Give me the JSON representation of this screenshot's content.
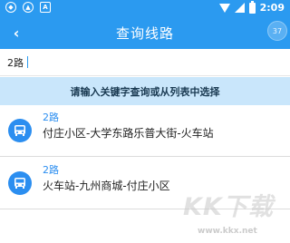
{
  "status_bar": {
    "left_icons": [
      "shield-icon",
      "navigation-icon",
      "a-icon"
    ],
    "time": "2:09"
  },
  "header": {
    "title": "查询线路",
    "badge": "37"
  },
  "search": {
    "value": "2路",
    "placeholder": ""
  },
  "hint": "请输入关键字查询或从列表中选择",
  "routes": [
    {
      "name": "2路",
      "stops": "付庄小区-大学东路乐普大街-火车站"
    },
    {
      "name": "2路",
      "stops": "火车站-九州商城-付庄小区"
    }
  ],
  "watermark": {
    "logo": "KK下载",
    "url": "www.kkx.net"
  },
  "colors": {
    "primary": "#2b9af0",
    "hint_bg": "#c9e6fb",
    "route_name": "#2b8ef0"
  }
}
